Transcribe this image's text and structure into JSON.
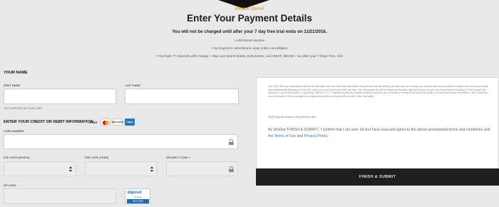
{
  "header": {
    "step": "Almost Done!",
    "title": "Enter Your Payment Details",
    "subtitle": "You will not be charged until after your 7 day free trial ends on 11/21/2016.",
    "bullets": [
      "• Add Extras anytime",
      "• No long-term commitment, easy online cancellation",
      "• You'll get 77 channels with Orange + Blue and Sports Extras, Kids Extras, and HBO®, $69.99 + tax after your 7 Days Free."
    ],
    "edit_link": "Edit"
  },
  "name_section": {
    "heading": "YOUR NAME",
    "first_name_label": "FIRST NAME",
    "last_name_label": "LAST NAME",
    "hint": "*AS IT APPEARS ON YOUR CARD",
    "first_name_value": "",
    "last_name_value": ""
  },
  "card_section": {
    "heading": "ENTER YOUR CREDIT OR DEBIT INFORMATION",
    "card_logos": [
      "VISA",
      "MasterCard",
      "DISCOVER",
      "AMEX"
    ],
    "card_number_label": "CARD NUMBER",
    "card_number_value": "",
    "exp_month_label": "EXP. DATE (MONTH)",
    "exp_year_label": "EXP. DATE (YEAR)",
    "security_code_label": "SECURITY CODE",
    "security_info": "●",
    "zip_label": "ZIP CODE",
    "zip_value": ""
  },
  "badge": {
    "logo": "digicert",
    "sub": "Trusted",
    "strip": "SECURE"
  },
  "terms": {
    "body": "Your Sling Television subscription and free trial will begin when you click Finish and Submit. By clicking Finish and Submit, you authorize us to charge your selected plan to your method of payment on a recurring monthly basis automatically following your free trial, unless you cancel before your free trial ends. Your subscription fee will be charged on the same date each month, and you can cancel anytime by going to 'Your Account' and clicking on 'Cancel Subscription' or by calling 1-888-363-1777. Programming fees are charged monthly in advance and no credits or refunds will be issued for partial or unused months after cancellation. Offer is limited to one per customer. Prices, packages and programming subject to change without notice. Taxes may apply.",
    "link": "FAQ® may be located on the preference tab",
    "confirm_prefix": "By clicking 'FINISH & SUBMIT', I confirm that I am over 18 and have read and agree to the above promotional terms and conditions and the",
    "confirm_link_1": "Terms of Use",
    "confirm_and": "and",
    "confirm_link_2": "Privacy Policy",
    "confirm_suffix": ".",
    "submit_label": "FINISH & SUBMIT"
  }
}
